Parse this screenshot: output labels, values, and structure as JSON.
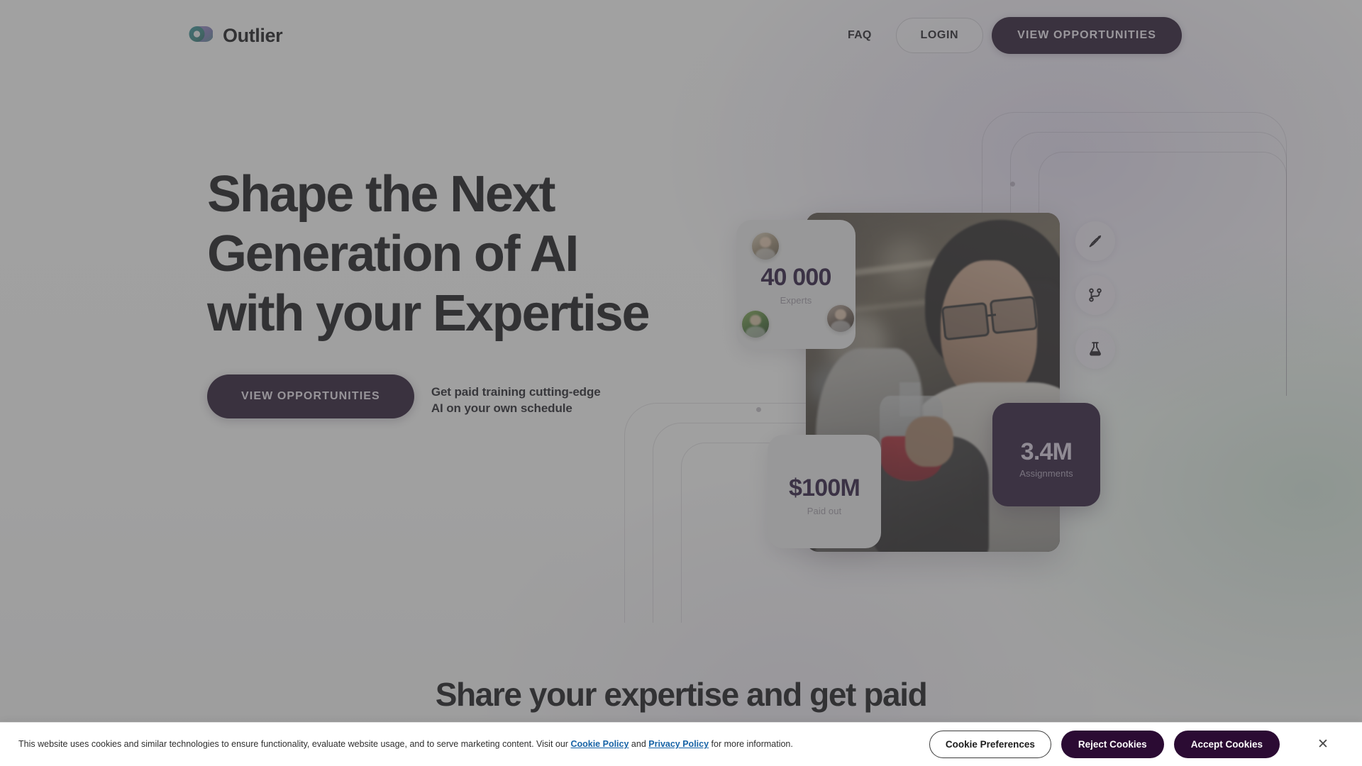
{
  "brand": {
    "name": "Outlier",
    "logo_icon": "outlier-ring-logo"
  },
  "nav": {
    "faq_label": "FAQ",
    "login_label": "LOGIN",
    "cta_label": "VIEW OPPORTUNITIES"
  },
  "hero": {
    "title": "Shape the Next\nGeneration of AI\nwith your Expertise",
    "cta_label": "VIEW OPPORTUNITIES",
    "subtitle": "Get paid training cutting-edge\nAI on your own schedule",
    "photo_alt": "scientist-holding-flask"
  },
  "stats": [
    {
      "value": "40 000",
      "label": "Experts"
    },
    {
      "value": "$100M",
      "label": "Paid out"
    },
    {
      "value": "3.4M",
      "label": "Assignments"
    }
  ],
  "rail": [
    {
      "icon": "pen-nib-icon"
    },
    {
      "icon": "git-branch-icon"
    },
    {
      "icon": "flask-icon"
    }
  ],
  "next_section": {
    "title": "Share your expertise and get paid"
  },
  "cookie": {
    "text_before": "This website uses cookies and similar technologies to ensure functionality, evaluate website usage, and to serve marketing content. Visit our",
    "cookie_policy_label": "Cookie Policy",
    "conjunction": "and",
    "privacy_policy_label": "Privacy Policy",
    "text_after": "for more information.",
    "preferences_label": "Cookie Preferences",
    "reject_label": "Reject Cookies",
    "accept_label": "Accept Cookies",
    "close_icon": "close-icon",
    "close_glyph": "✕"
  },
  "colors": {
    "brand_dark": "#1b0b26",
    "card_dark": "#200d2f",
    "stat_text": "#1d0b33",
    "link_blue": "#1763a6",
    "cookie_btn": "#2b0b33"
  }
}
